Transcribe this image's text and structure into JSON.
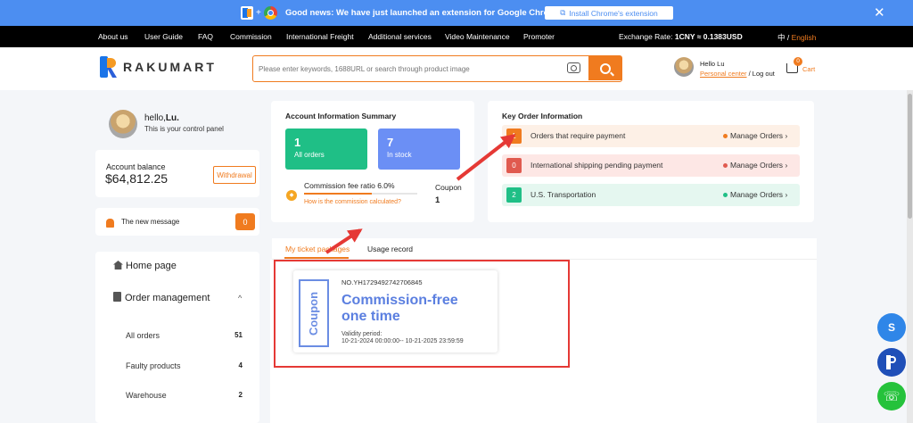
{
  "banner": {
    "news": "Good news: We have just launched an extension for Google Chrome",
    "extension_button": "Install Chrome's extension",
    "close": "✕"
  },
  "topnav": {
    "items": [
      "About us",
      "User Guide",
      "FAQ",
      "Commission",
      "International Freight",
      "Additional services",
      "Video Maintenance",
      "Promoter"
    ],
    "exchange_label": "Exchange Rate:",
    "exchange_value": "1CNY ≈ 0.1383USD",
    "lang_zh": "中",
    "lang_sep": " / ",
    "lang_en": "English"
  },
  "header": {
    "logo_text": "RAKUMART",
    "search_placeholder": "Please enter keywords, 1688URL or search through product image",
    "user_name": "Hello Lu",
    "personal_center": "Personal center",
    "logout_sep": " / ",
    "logout": "Log out",
    "cart_count": "0",
    "cart_label": "Cart"
  },
  "profile": {
    "hello_prefix": "hello,",
    "name": "Lu.",
    "subtitle": "This is your control panel"
  },
  "balance": {
    "label": "Account balance",
    "value": "$64,812.25",
    "withdraw": "Withdrawal"
  },
  "message": {
    "label": "The new message",
    "count": "0"
  },
  "menu": {
    "home": "Home page",
    "order_management": "Order management",
    "caret": "^",
    "items": [
      {
        "label": "All orders",
        "count": "51"
      },
      {
        "label": "Faulty products",
        "count": "4"
      },
      {
        "label": "Warehouse",
        "count": "2"
      }
    ]
  },
  "summary": {
    "title": "Account Information Summary",
    "orders_count": "1",
    "orders_label": "All orders",
    "stock_count": "7",
    "stock_label": "In stock",
    "commission_label": "Commission fee ratio 6.0%",
    "commission_ratio": 0.6,
    "commission_link": "How is the commission calculated?",
    "coupon_label": "Coupon",
    "coupon_count": "1"
  },
  "key_info": {
    "title": "Key Order Information",
    "rows": [
      {
        "count": "1",
        "label": "Orders that require payment",
        "action": "Manage Orders",
        "color": "#f07b1f",
        "bg": "#fdf0e6"
      },
      {
        "count": "0",
        "label": "International shipping pending payment",
        "action": "Manage Orders",
        "color": "#e05a4f",
        "bg": "#fde7e5"
      },
      {
        "count": "2",
        "label": "U.S. Transportation",
        "action": "Manage Orders",
        "color": "#1fbf86",
        "bg": "#e5f7f0"
      }
    ]
  },
  "tabs": {
    "packages": "My ticket packages",
    "usage": "Usage record"
  },
  "ticket": {
    "side_label": "Coupon",
    "number": "NO.YH1729492742706845",
    "title_line1": "Commission-free",
    "title_line2": "one time",
    "validity_label": "Validity period:",
    "validity_range": "10-21-2024 00:00:00-- 10-21-2025 23:59:59"
  },
  "floating": {
    "skype": "S",
    "whatsapp": "☏"
  },
  "colors": {
    "accent": "#f07b1f",
    "banner": "#4c8ef1",
    "green_tile": "#1fbf86",
    "blue_tile": "#6b8ff5",
    "annotation": "#e53935"
  }
}
